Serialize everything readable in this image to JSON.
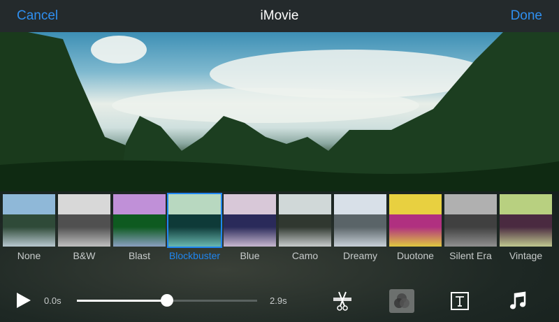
{
  "topbar": {
    "cancel": "Cancel",
    "title": "iMovie",
    "done": "Done"
  },
  "filters": [
    {
      "label": "None",
      "sky": "#8fb8d8",
      "land": "#2f4a38",
      "water": "#b8c8d0",
      "selected": false
    },
    {
      "label": "B&W",
      "sky": "#d8d8d8",
      "land": "#505050",
      "water": "#c0c0c0",
      "selected": false
    },
    {
      "label": "Blast",
      "sky": "#c090d8",
      "land": "#0e5a20",
      "water": "#8aa0c0",
      "selected": false
    },
    {
      "label": "Blockbuster",
      "sky": "#b8d8c0",
      "land": "#0e3a38",
      "water": "#6ab8b0",
      "selected": true
    },
    {
      "label": "Blue",
      "sky": "#d8c8d8",
      "land": "#2a2a5a",
      "water": "#c8b8d0",
      "selected": false
    },
    {
      "label": "Camo",
      "sky": "#d0d8d8",
      "land": "#303830",
      "water": "#c8cccc",
      "selected": false
    },
    {
      "label": "Dreamy",
      "sky": "#d8e0e8",
      "land": "#5a6468",
      "water": "#c8d0d8",
      "selected": false
    },
    {
      "label": "Duotone",
      "sky": "#e8d040",
      "land": "#b03080",
      "water": "#e0c840",
      "selected": false
    },
    {
      "label": "Silent Era",
      "sky": "#b0b0b0",
      "land": "#404040",
      "water": "#909090",
      "selected": false
    },
    {
      "label": "Vintage",
      "sky": "#b8d080",
      "land": "#4a2a40",
      "water": "#c0c890",
      "selected": false
    }
  ],
  "playback": {
    "start": "0.0s",
    "end": "2.9s",
    "progress": 0.5
  },
  "colors": {
    "accent": "#1f86f0"
  }
}
